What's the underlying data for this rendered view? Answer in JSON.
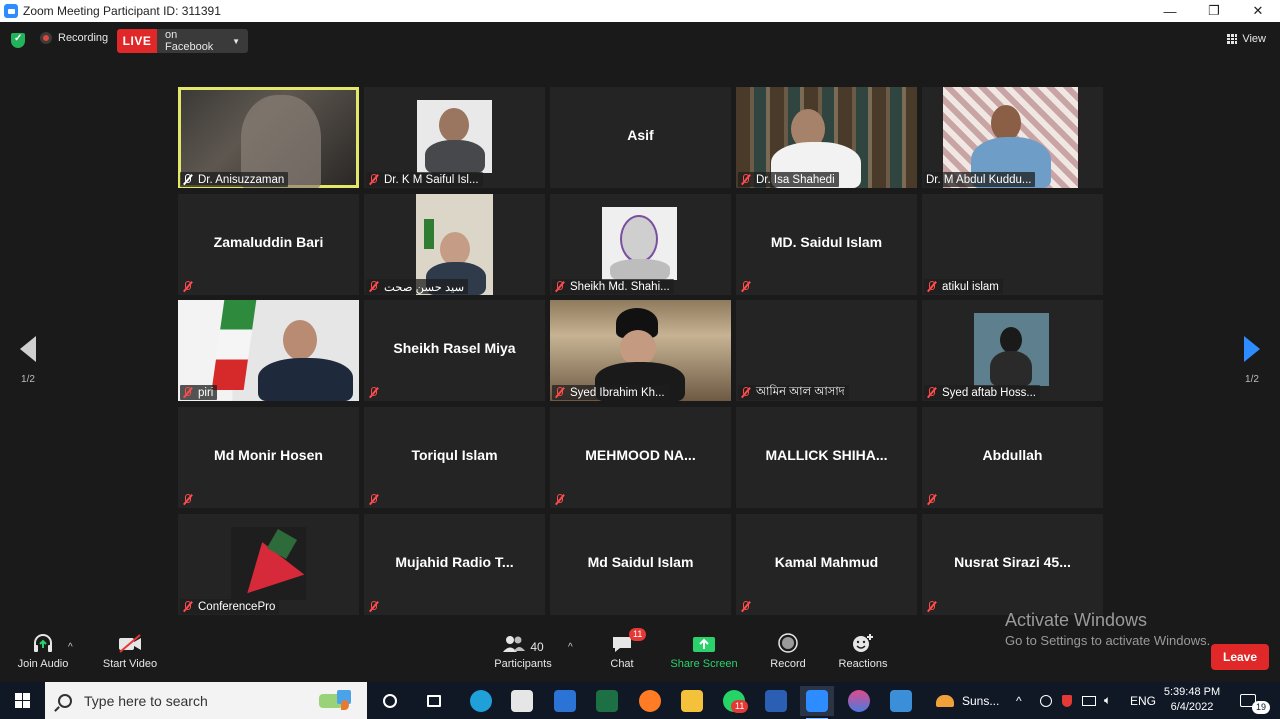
{
  "window": {
    "title": "Zoom Meeting Participant ID: 311391",
    "minimize": "—",
    "restore": "❐",
    "close": "✕"
  },
  "topbar": {
    "recording_label": "Recording",
    "live_label": "LIVE",
    "stream_label": "on Facebook",
    "view_label": "View"
  },
  "pager": {
    "left_page": "1/2",
    "right_page": "1/2"
  },
  "tiles": [
    {
      "name": "Dr. Anisuzzaman",
      "big": ""
    },
    {
      "name": "Dr. K M Saiful Isl...",
      "big": ""
    },
    {
      "name": "",
      "big": "Asif"
    },
    {
      "name": "Dr. Isa Shahedi",
      "big": ""
    },
    {
      "name": "Dr. M Abdul Kuddu...",
      "big": ""
    },
    {
      "name": "",
      "big": "Zamaluddin Bari"
    },
    {
      "name": "سید حسن صحت",
      "big": ""
    },
    {
      "name": "Sheikh Md. Shahi...",
      "big": ""
    },
    {
      "name": "",
      "big": "MD. Saidul Islam"
    },
    {
      "name": "atikul islam",
      "big": ""
    },
    {
      "name": "piri",
      "big": ""
    },
    {
      "name": "",
      "big": "Sheikh Rasel Miya"
    },
    {
      "name": "Syed Ibrahim Kh...",
      "big": ""
    },
    {
      "name": "আমিন আল আসাদ",
      "big": ""
    },
    {
      "name": "Syed aftab Hoss...",
      "big": ""
    },
    {
      "name": "",
      "big": "Md Monir Hosen"
    },
    {
      "name": "",
      "big": "Toriqul Islam"
    },
    {
      "name": "",
      "big": "MEHMOOD  NA..."
    },
    {
      "name": "",
      "big": "MALLICK  SHIHA..."
    },
    {
      "name": "",
      "big": "Abdullah"
    },
    {
      "name": "ConferencePro",
      "big": ""
    },
    {
      "name": "",
      "big": "Mujahid  Radio  T..."
    },
    {
      "name": "",
      "big": "Md Saidul Islam"
    },
    {
      "name": "",
      "big": "Kamal Mahmud"
    },
    {
      "name": "",
      "big": "Nusrat  Sirazi  45..."
    }
  ],
  "toolbar": {
    "join_audio": "Join Audio",
    "start_video": "Start Video",
    "participants": "Participants",
    "participants_count": "40",
    "chat": "Chat",
    "chat_badge": "11",
    "share_screen": "Share Screen",
    "record": "Record",
    "reactions": "Reactions",
    "leave": "Leave"
  },
  "watermark": {
    "line1": "Activate Windows",
    "line2": "Go to Settings to activate Windows."
  },
  "taskbar": {
    "search_placeholder": "Type here to search",
    "weather": "Suns...",
    "language": "ENG",
    "time": "5:39:48 PM",
    "date": "6/4/2022",
    "whatsapp_badge": "11",
    "notif_count": "19"
  },
  "colors": {
    "accent_blue": "#2d8cff",
    "live_red": "#e02828",
    "share_green": "#2bd16b",
    "active_speaker": "#e3e86a",
    "muted_red": "#ff4b4b"
  }
}
